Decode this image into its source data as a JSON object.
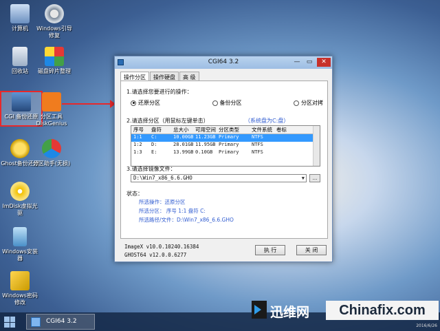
{
  "desktop": {
    "icons": [
      {
        "label": "计算机"
      },
      {
        "label": "Windows引导修复"
      },
      {
        "label": "回收站"
      },
      {
        "label": "磁盘碎片整理"
      },
      {
        "label": "CGI 备份还原"
      },
      {
        "label": "分区工具DiskGenius"
      },
      {
        "label": "Ghost备份还原"
      },
      {
        "label": "分区助手(无损)"
      },
      {
        "label": "ImDisk虚拟光驱"
      },
      {
        "label": "Windows安装器"
      },
      {
        "label": "Windows密码修改"
      }
    ]
  },
  "window": {
    "title": "CGI64  3.2",
    "controls": {
      "minimize": "—",
      "maximize": "▭",
      "close": "✕"
    },
    "tabs": [
      "操作分区",
      "操作硬盘",
      "高 级"
    ],
    "section1": {
      "label": "1.请选择您要进行的操作：",
      "options": [
        {
          "label": "还原分区",
          "selected": true
        },
        {
          "label": "备份分区",
          "selected": false
        },
        {
          "label": "分区对拷",
          "selected": false
        }
      ]
    },
    "section2": {
      "label": "2.请选择分区（用鼠标左键单击）",
      "disk_info": "（系统盘为C:盘）",
      "columns": [
        "序号",
        "盘符",
        "总大小",
        "可用空间",
        "分区类型",
        "文件系统",
        "卷标"
      ],
      "rows": [
        [
          "1:1",
          "C:",
          "10.00GB",
          "11.23GB",
          "Primary",
          "NTFS",
          ""
        ],
        [
          "1:2",
          "D:",
          "28.01GB",
          "11.95GB",
          "Primary",
          "NTFS",
          ""
        ],
        [
          "1:3",
          "E:",
          "13.99GB",
          "0.10GB",
          "Primary",
          "NTFS",
          ""
        ]
      ],
      "selected_row": 0
    },
    "section3": {
      "label": "3.请选择镜像文件：",
      "path": "D:\\Win7_x86_6.6.GHO",
      "browse": "..."
    },
    "status": {
      "label": "状态：",
      "operation": "所选操作：还原分区",
      "partition": "所选分区：  序号 1:1         盘符 C:",
      "file": "所选路径/文件：D:\\Win7_x86_6.6.GHO"
    },
    "footer": {
      "imagex": "ImageX v10.0.10240.16384",
      "ghost": "GHOST64 v12.0.0.6277"
    },
    "buttons": {
      "execute": "执 行",
      "close": "关 闭"
    }
  },
  "taskbar": {
    "item": "CGI64  3.2"
  },
  "watermark": {
    "cn": "迅维网",
    "en": "Chinafix.com"
  },
  "clock": "2016/6/26"
}
